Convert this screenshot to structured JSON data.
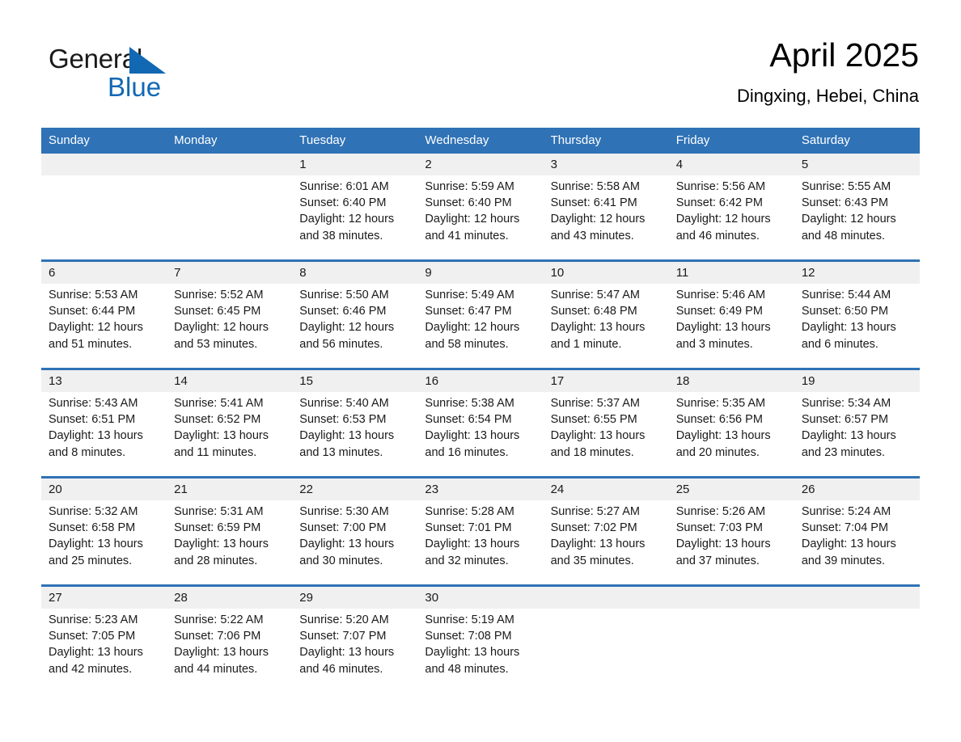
{
  "brand": {
    "name_part1": "General",
    "name_part2": "Blue",
    "accent_color": "#1268b3"
  },
  "header": {
    "title": "April 2025",
    "location": "Dingxing, Hebei, China"
  },
  "theme": {
    "header_bg": "#2f72b6",
    "daynum_bg": "#f0f0f0",
    "rule_color": "#2f72b6"
  },
  "weekdays": [
    "Sunday",
    "Monday",
    "Tuesday",
    "Wednesday",
    "Thursday",
    "Friday",
    "Saturday"
  ],
  "weeks": [
    [
      {
        "day": "",
        "lines": []
      },
      {
        "day": "",
        "lines": []
      },
      {
        "day": "1",
        "lines": [
          "Sunrise: 6:01 AM",
          "Sunset: 6:40 PM",
          "Daylight: 12 hours",
          "and 38 minutes."
        ]
      },
      {
        "day": "2",
        "lines": [
          "Sunrise: 5:59 AM",
          "Sunset: 6:40 PM",
          "Daylight: 12 hours",
          "and 41 minutes."
        ]
      },
      {
        "day": "3",
        "lines": [
          "Sunrise: 5:58 AM",
          "Sunset: 6:41 PM",
          "Daylight: 12 hours",
          "and 43 minutes."
        ]
      },
      {
        "day": "4",
        "lines": [
          "Sunrise: 5:56 AM",
          "Sunset: 6:42 PM",
          "Daylight: 12 hours",
          "and 46 minutes."
        ]
      },
      {
        "day": "5",
        "lines": [
          "Sunrise: 5:55 AM",
          "Sunset: 6:43 PM",
          "Daylight: 12 hours",
          "and 48 minutes."
        ]
      }
    ],
    [
      {
        "day": "6",
        "lines": [
          "Sunrise: 5:53 AM",
          "Sunset: 6:44 PM",
          "Daylight: 12 hours",
          "and 51 minutes."
        ]
      },
      {
        "day": "7",
        "lines": [
          "Sunrise: 5:52 AM",
          "Sunset: 6:45 PM",
          "Daylight: 12 hours",
          "and 53 minutes."
        ]
      },
      {
        "day": "8",
        "lines": [
          "Sunrise: 5:50 AM",
          "Sunset: 6:46 PM",
          "Daylight: 12 hours",
          "and 56 minutes."
        ]
      },
      {
        "day": "9",
        "lines": [
          "Sunrise: 5:49 AM",
          "Sunset: 6:47 PM",
          "Daylight: 12 hours",
          "and 58 minutes."
        ]
      },
      {
        "day": "10",
        "lines": [
          "Sunrise: 5:47 AM",
          "Sunset: 6:48 PM",
          "Daylight: 13 hours",
          "and 1 minute."
        ]
      },
      {
        "day": "11",
        "lines": [
          "Sunrise: 5:46 AM",
          "Sunset: 6:49 PM",
          "Daylight: 13 hours",
          "and 3 minutes."
        ]
      },
      {
        "day": "12",
        "lines": [
          "Sunrise: 5:44 AM",
          "Sunset: 6:50 PM",
          "Daylight: 13 hours",
          "and 6 minutes."
        ]
      }
    ],
    [
      {
        "day": "13",
        "lines": [
          "Sunrise: 5:43 AM",
          "Sunset: 6:51 PM",
          "Daylight: 13 hours",
          "and 8 minutes."
        ]
      },
      {
        "day": "14",
        "lines": [
          "Sunrise: 5:41 AM",
          "Sunset: 6:52 PM",
          "Daylight: 13 hours",
          "and 11 minutes."
        ]
      },
      {
        "day": "15",
        "lines": [
          "Sunrise: 5:40 AM",
          "Sunset: 6:53 PM",
          "Daylight: 13 hours",
          "and 13 minutes."
        ]
      },
      {
        "day": "16",
        "lines": [
          "Sunrise: 5:38 AM",
          "Sunset: 6:54 PM",
          "Daylight: 13 hours",
          "and 16 minutes."
        ]
      },
      {
        "day": "17",
        "lines": [
          "Sunrise: 5:37 AM",
          "Sunset: 6:55 PM",
          "Daylight: 13 hours",
          "and 18 minutes."
        ]
      },
      {
        "day": "18",
        "lines": [
          "Sunrise: 5:35 AM",
          "Sunset: 6:56 PM",
          "Daylight: 13 hours",
          "and 20 minutes."
        ]
      },
      {
        "day": "19",
        "lines": [
          "Sunrise: 5:34 AM",
          "Sunset: 6:57 PM",
          "Daylight: 13 hours",
          "and 23 minutes."
        ]
      }
    ],
    [
      {
        "day": "20",
        "lines": [
          "Sunrise: 5:32 AM",
          "Sunset: 6:58 PM",
          "Daylight: 13 hours",
          "and 25 minutes."
        ]
      },
      {
        "day": "21",
        "lines": [
          "Sunrise: 5:31 AM",
          "Sunset: 6:59 PM",
          "Daylight: 13 hours",
          "and 28 minutes."
        ]
      },
      {
        "day": "22",
        "lines": [
          "Sunrise: 5:30 AM",
          "Sunset: 7:00 PM",
          "Daylight: 13 hours",
          "and 30 minutes."
        ]
      },
      {
        "day": "23",
        "lines": [
          "Sunrise: 5:28 AM",
          "Sunset: 7:01 PM",
          "Daylight: 13 hours",
          "and 32 minutes."
        ]
      },
      {
        "day": "24",
        "lines": [
          "Sunrise: 5:27 AM",
          "Sunset: 7:02 PM",
          "Daylight: 13 hours",
          "and 35 minutes."
        ]
      },
      {
        "day": "25",
        "lines": [
          "Sunrise: 5:26 AM",
          "Sunset: 7:03 PM",
          "Daylight: 13 hours",
          "and 37 minutes."
        ]
      },
      {
        "day": "26",
        "lines": [
          "Sunrise: 5:24 AM",
          "Sunset: 7:04 PM",
          "Daylight: 13 hours",
          "and 39 minutes."
        ]
      }
    ],
    [
      {
        "day": "27",
        "lines": [
          "Sunrise: 5:23 AM",
          "Sunset: 7:05 PM",
          "Daylight: 13 hours",
          "and 42 minutes."
        ]
      },
      {
        "day": "28",
        "lines": [
          "Sunrise: 5:22 AM",
          "Sunset: 7:06 PM",
          "Daylight: 13 hours",
          "and 44 minutes."
        ]
      },
      {
        "day": "29",
        "lines": [
          "Sunrise: 5:20 AM",
          "Sunset: 7:07 PM",
          "Daylight: 13 hours",
          "and 46 minutes."
        ]
      },
      {
        "day": "30",
        "lines": [
          "Sunrise: 5:19 AM",
          "Sunset: 7:08 PM",
          "Daylight: 13 hours",
          "and 48 minutes."
        ]
      },
      {
        "day": "",
        "lines": []
      },
      {
        "day": "",
        "lines": []
      },
      {
        "day": "",
        "lines": []
      }
    ]
  ]
}
